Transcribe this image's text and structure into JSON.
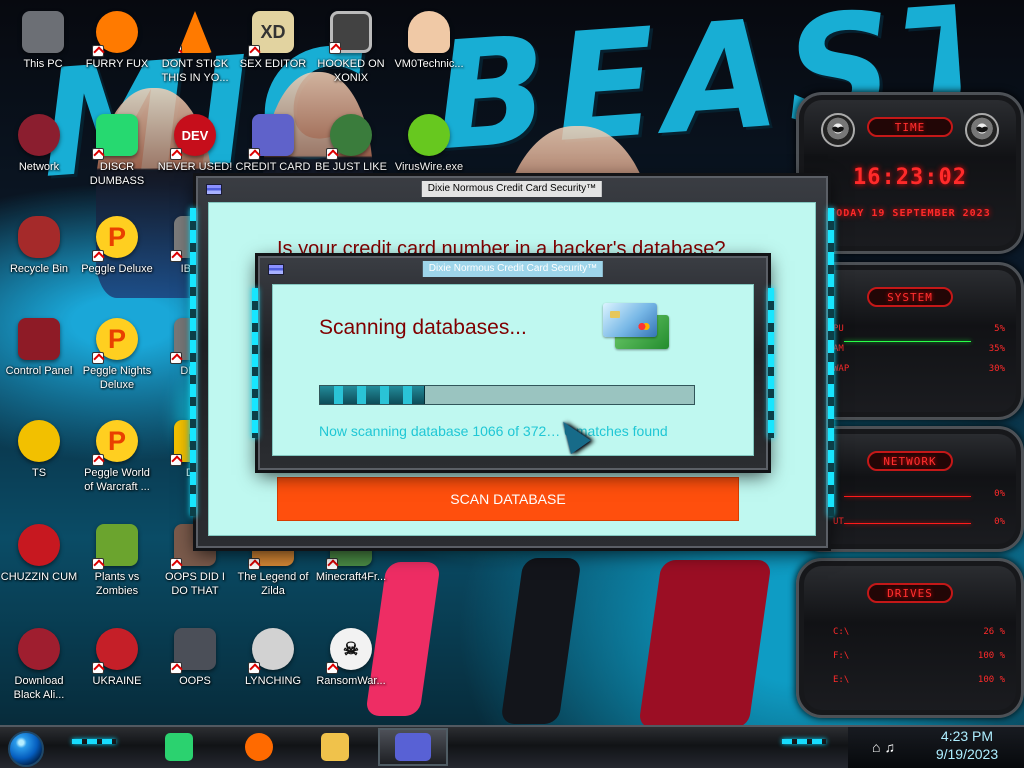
{
  "desktop": {
    "wallpaper_text": "MIC BEAST",
    "icons": [
      {
        "label": "This PC",
        "icon": "computer-icon",
        "color": "#6c6f75"
      },
      {
        "label": "FURRY FUX",
        "icon": "firefox-icon",
        "color": "#ff7a00"
      },
      {
        "label": "DONT STICK THIS IN YO...",
        "icon": "traffic-cone-icon",
        "color": "#ff7a00"
      },
      {
        "label": "SEX EDITOR",
        "icon": "hex-editor-icon",
        "color": "#e2d3a0"
      },
      {
        "label": "HOOKED ON XONIX",
        "icon": "game-grid-icon",
        "color": "#424242"
      },
      {
        "label": "VM0Technic...",
        "icon": "doctor-icon",
        "color": "#f0c9a6"
      },
      {
        "label": "Network",
        "icon": "network-icon",
        "color": "#8b1e2f"
      },
      {
        "label": "DISCR DUMBASS",
        "icon": "discord-icon",
        "color": "#26d970"
      },
      {
        "label": "NEVER USED!",
        "icon": "dev-icon",
        "color": "#c60e1b"
      },
      {
        "label": "CREDIT CARD",
        "icon": "credit-card-icon",
        "color": "#5f62ca"
      },
      {
        "label": "BE JUST LIKE",
        "icon": "santa-icon",
        "color": "#3a7c3c"
      },
      {
        "label": "VirusWire.exe",
        "icon": "lime-icon",
        "color": "#67c81f"
      },
      {
        "label": "Recycle Bin",
        "icon": "recycle-bin-icon",
        "color": "#a52a2a"
      },
      {
        "label": "Peggle Deluxe",
        "icon": "peggle-icon",
        "color": "#ffcf20"
      },
      {
        "label": "Control Panel",
        "icon": "control-panel-icon",
        "color": "#8e1b26"
      },
      {
        "label": "Peggle Nights Deluxe",
        "icon": "peggle-icon",
        "color": "#ffcf20"
      },
      {
        "label": "Peggle World of Warcraft ...",
        "icon": "peggle-icon",
        "color": "#ffcf20"
      },
      {
        "label": "CHUZZIN CUM",
        "icon": "fuzzy-creature-icon",
        "color": "#c71820"
      },
      {
        "label": "Plants vs Zombies",
        "icon": "plant-icon",
        "color": "#6ba42e"
      },
      {
        "label": "OOPS DID I DO THAT",
        "icon": "photo-icon",
        "color": "#7a5a4b"
      },
      {
        "label": "The Legend of Zilda",
        "icon": "legend-icon",
        "color": "#d68835"
      },
      {
        "label": "Minecraft4Fr...",
        "icon": "minecraft-icon",
        "color": "#4b8b45"
      },
      {
        "label": "Download Black Ali...",
        "icon": "alien-icon",
        "color": "#9f1e2f"
      },
      {
        "label": "UKRAINE",
        "icon": "radiation-icon",
        "color": "#c51f28"
      },
      {
        "label": "OOPS",
        "icon": "terminal-icon",
        "color": "#4b4f58"
      },
      {
        "label": "LYNCHING",
        "icon": "rope-icon",
        "color": "#d2d2d2"
      },
      {
        "label": "RansomWar...",
        "icon": "skull-icon",
        "color": "#f2f2f2"
      },
      {
        "label": "IBRAI",
        "icon": "library-icon",
        "color": "#7a7a7a"
      },
      {
        "label": "DEEZ",
        "icon": "printer-icon",
        "color": "#777777"
      },
      {
        "label": "DIE",
        "icon": "die-icon",
        "color": "#f2c000"
      },
      {
        "label": "TS",
        "icon": "character-icon",
        "color": "#f2c000"
      }
    ]
  },
  "gadgets": {
    "time": {
      "title": "TIME",
      "clock": "16:23:02",
      "date": "TODAY 19 SEPTEMBER 2023"
    },
    "system": {
      "title": "SYSTEM",
      "rows": [
        {
          "label": "PU",
          "value": "5%"
        },
        {
          "label": "AM",
          "value": "35%"
        },
        {
          "label": "WAP",
          "value": "30%"
        }
      ]
    },
    "network": {
      "title": "NETWORK",
      "rows": [
        {
          "label": "",
          "value": "0%"
        },
        {
          "label": "UT",
          "value": "0%"
        }
      ]
    },
    "drives": {
      "title": "DRIVES",
      "rows": [
        {
          "label": "C:\\",
          "value": "26 %"
        },
        {
          "label": "F:\\",
          "value": "100 %"
        },
        {
          "label": "E:\\",
          "value": "100 %"
        }
      ]
    }
  },
  "outer_window": {
    "title": "Dixie Normous Credit Card Security™",
    "question": "Is your credit card number in a hacker's database?",
    "button": "SCAN DATABASE"
  },
  "scan_window": {
    "title": "Dixie Normous Credit Card Security™",
    "heading": "Scanning databases...",
    "progress_fraction": 0.28,
    "status": "Now scanning database 1066 of 372… 0 matches found"
  },
  "taskbar": {
    "items": [
      {
        "name": "discord",
        "icon": "discord-icon",
        "color": "#2bd26f",
        "active": false
      },
      {
        "name": "firefox",
        "icon": "firefox-icon",
        "color": "#ff6a00",
        "active": false
      },
      {
        "name": "file-explorer",
        "icon": "folder-icon",
        "color": "#f0c24b",
        "active": false
      },
      {
        "name": "credit-card-app",
        "icon": "credit-card-icon",
        "color": "#5861d5",
        "active": true
      }
    ],
    "clock_time": "4:23 PM",
    "clock_date": "9/19/2023"
  }
}
